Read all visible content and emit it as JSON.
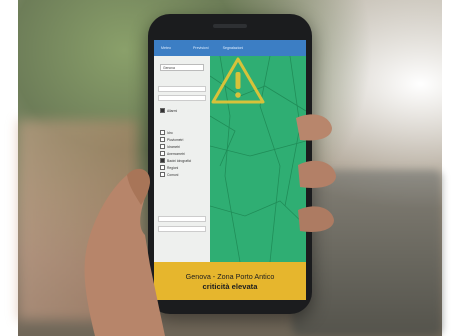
{
  "photo": {
    "subject": "hand-holding-smartphone"
  },
  "app": {
    "nav": {
      "items": [
        "Meteo",
        "Previsioni",
        "Segnalazioni"
      ]
    },
    "sidebar": {
      "selected_area": "Genova",
      "checkbox_items": [
        {
          "label": "Allarmi",
          "checked": true
        },
        {
          "label": "Idro",
          "checked": false
        },
        {
          "label": "Pluviometri",
          "checked": false
        },
        {
          "label": "Idrometri",
          "checked": false
        },
        {
          "label": "Anemometri",
          "checked": false
        },
        {
          "label": "Bacini idrografici",
          "checked": true
        },
        {
          "label": "Regioni",
          "checked": false
        },
        {
          "label": "Comuni",
          "checked": false
        }
      ]
    },
    "map": {
      "area_color": "#2fae73",
      "warning_icon": "warning-triangle-icon"
    },
    "banner": {
      "location": "Genova - Zona Porto Antico",
      "status": "criticità elevata",
      "color": "#e6b62d"
    }
  }
}
